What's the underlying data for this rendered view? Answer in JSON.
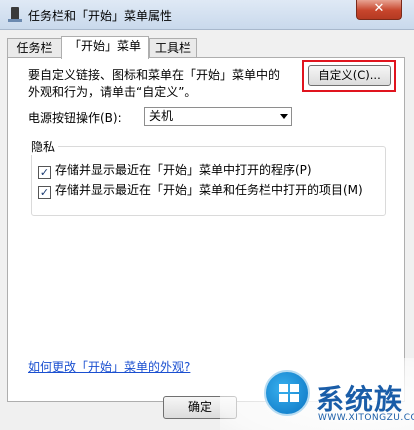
{
  "window": {
    "title": "任务栏和「开始」菜单属性",
    "close_label": "✕"
  },
  "tabs": [
    {
      "label": "任务栏",
      "active": false
    },
    {
      "label": "「开始」菜单",
      "active": true
    },
    {
      "label": "工具栏",
      "active": false
    }
  ],
  "start_menu": {
    "description_line1": "要自定义链接、图标和菜单在「开始」菜单中的",
    "description_line2": "外观和行为，请单击“自定义”。",
    "customize_button": "自定义(C)...",
    "power_label": "电源按钮操作(B):",
    "power_value": "关机",
    "privacy": {
      "title": "隐私",
      "items": [
        {
          "label": "存储并显示最近在「开始」菜单中打开的程序(P)",
          "checked": true
        },
        {
          "label": "存储并显示最近在「开始」菜单和任务栏中打开的项目(M)",
          "checked": true
        }
      ]
    },
    "help_link": "如何更改「开始」菜单的外观?"
  },
  "footer": {
    "ok_label": "确定"
  },
  "watermark": {
    "name": "系统族",
    "url": "WWW.XITONGZU.COM"
  },
  "colors": {
    "highlight_frame": "#e0141e",
    "link": "#1a4fd0",
    "close_button": "#c7452c"
  }
}
